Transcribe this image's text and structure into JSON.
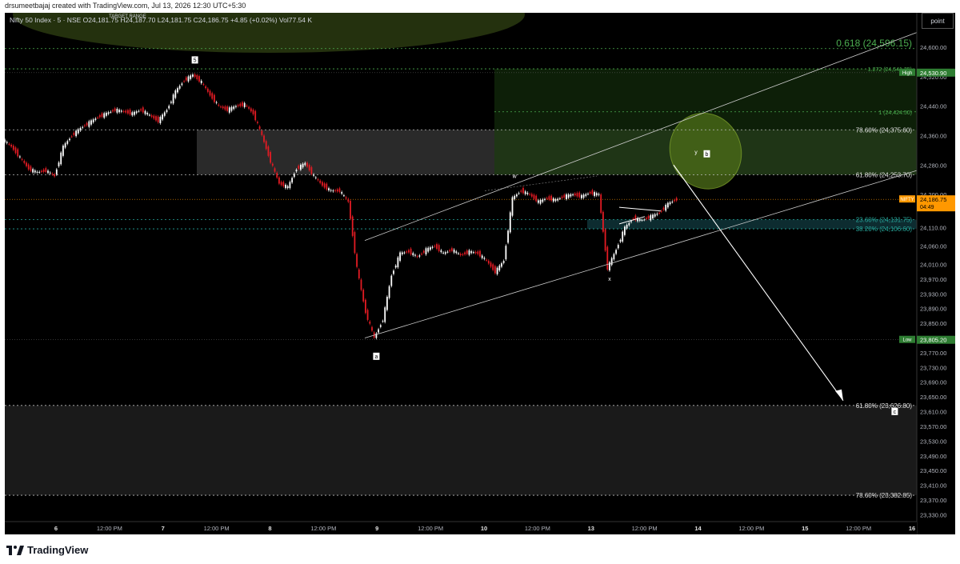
{
  "top_caption": "drsumeetbajaj created with TradingView.com, Jul 13, 2026 12:30 UTC+5:30",
  "symbol_line": "Nifty 50 Index · 5 · NSE  O24,181.75  H24,187.70  L24,181.75  C24,186.75  +4.85 (+0.02%)  Vol77.54 K",
  "target_range_label": "TARGET RANGE",
  "unit_button": "point",
  "branding": "TradingView",
  "colors": {
    "background": "#000000",
    "up_candle": "#ffffff",
    "down_candle": "#e31b23",
    "fib_green": "#4caf50",
    "fib_cyan": "#26a69a",
    "zone_grey": "#2a2a2a",
    "zone_green": "#1b3a12",
    "price_tag": "#ff9800"
  },
  "chart_data": {
    "type": "candlestick",
    "ylim": [
      23320,
      24650
    ],
    "y_ticks": [
      "24,600.00",
      "24,520.00",
      "24,440.00",
      "24,360.00",
      "24,280.00",
      "24,200.00",
      "24,110.00",
      "24,060.00",
      "24,010.00",
      "23,970.00",
      "23,930.00",
      "23,890.00",
      "23,850.00",
      "23,810.00",
      "23,770.00",
      "23,730.00",
      "23,690.00",
      "23,650.00",
      "23,610.00",
      "23,570.00",
      "23,530.00",
      "23,490.00",
      "23,450.00",
      "23,410.00",
      "23,370.00",
      "23,330.00"
    ],
    "x_ticks": [
      "6",
      "12:00 PM",
      "7",
      "12:00 PM",
      "8",
      "12:00 PM",
      "9",
      "12:00 PM",
      "10",
      "12:00 PM",
      "13",
      "12:00 PM",
      "14",
      "12:00 PM",
      "15",
      "12:00 PM",
      "16"
    ],
    "price_path": [
      [
        0,
        24350
      ],
      [
        4,
        24330
      ],
      [
        8,
        24300
      ],
      [
        12,
        24270
      ],
      [
        16,
        24260
      ],
      [
        20,
        24265
      ],
      [
        24,
        24250
      ],
      [
        28,
        24330
      ],
      [
        32,
        24360
      ],
      [
        36,
        24380
      ],
      [
        40,
        24395
      ],
      [
        44,
        24410
      ],
      [
        48,
        24420
      ],
      [
        52,
        24430
      ],
      [
        56,
        24425
      ],
      [
        60,
        24420
      ],
      [
        64,
        24430
      ],
      [
        68,
        24415
      ],
      [
        72,
        24400
      ],
      [
        76,
        24430
      ],
      [
        80,
        24480
      ],
      [
        84,
        24510
      ],
      [
        88,
        24525
      ],
      [
        92,
        24505
      ],
      [
        96,
        24470
      ],
      [
        100,
        24440
      ],
      [
        104,
        24430
      ],
      [
        108,
        24440
      ],
      [
        112,
        24445
      ],
      [
        116,
        24420
      ],
      [
        120,
        24360
      ],
      [
        124,
        24290
      ],
      [
        128,
        24230
      ],
      [
        132,
        24220
      ],
      [
        136,
        24270
      ],
      [
        140,
        24285
      ],
      [
        144,
        24250
      ],
      [
        148,
        24225
      ],
      [
        152,
        24210
      ],
      [
        156,
        24210
      ],
      [
        160,
        24180
      ],
      [
        164,
        24000
      ],
      [
        168,
        23880
      ],
      [
        172,
        23810
      ],
      [
        176,
        23860
      ],
      [
        180,
        23980
      ],
      [
        184,
        24040
      ],
      [
        188,
        24045
      ],
      [
        192,
        24030
      ],
      [
        196,
        24050
      ],
      [
        200,
        24060
      ],
      [
        204,
        24040
      ],
      [
        208,
        24050
      ],
      [
        212,
        24035
      ],
      [
        216,
        24045
      ],
      [
        220,
        24040
      ],
      [
        224,
        24020
      ],
      [
        228,
        23990
      ],
      [
        232,
        24020
      ],
      [
        236,
        24190
      ],
      [
        240,
        24210
      ],
      [
        244,
        24200
      ],
      [
        248,
        24180
      ],
      [
        252,
        24190
      ],
      [
        256,
        24185
      ],
      [
        260,
        24195
      ],
      [
        264,
        24200
      ],
      [
        268,
        24195
      ],
      [
        272,
        24205
      ],
      [
        276,
        24200
      ],
      [
        280,
        24000
      ],
      [
        284,
        24050
      ],
      [
        288,
        24110
      ],
      [
        292,
        24135
      ],
      [
        296,
        24130
      ],
      [
        300,
        24140
      ],
      [
        304,
        24150
      ],
      [
        308,
        24175
      ],
      [
        312,
        24186.75
      ]
    ],
    "horizontal_levels": [
      {
        "label": "0.618 (24,596.15)",
        "value": 24596.15,
        "color": "fib_green"
      },
      {
        "label": "1.272 (24,541.25)",
        "value": 24541.25,
        "color": "fib_green"
      },
      {
        "label": "1 (24,424.50)",
        "value": 24424.5,
        "color": "fib_green"
      },
      {
        "label": "78.60% (24,375.60)",
        "value": 24375.6,
        "color": "white"
      },
      {
        "label": "61.80% (24,253.70)",
        "value": 24253.7,
        "color": "white"
      },
      {
        "label": "23.60% (24,131.75)",
        "value": 24131.75,
        "color": "fib_cyan"
      },
      {
        "label": "38.20% (24,106.60)",
        "value": 24106.6,
        "color": "fib_cyan"
      },
      {
        "label": "61.80% (23,626.80)",
        "value": 23626.8,
        "color": "white"
      },
      {
        "label": "78.60% (23,382.85)",
        "value": 23382.85,
        "color": "white"
      }
    ],
    "price_tags": [
      {
        "label": "High",
        "value_text": "24,530.90",
        "value": 24530.9
      },
      {
        "label": "NIFTY",
        "value_text": "24,186.75",
        "value": 24186.75,
        "sub": "04:49"
      },
      {
        "label": "Low",
        "value_text": "23,805.20",
        "value": 23805.2
      }
    ],
    "wave_labels": [
      {
        "text": "5",
        "price": 24560,
        "bar": 88
      },
      {
        "text": "a",
        "price": 23755,
        "bar": 172
      },
      {
        "text": "w",
        "price": 24245,
        "bar": 236
      },
      {
        "text": "x",
        "price": 23965,
        "bar": 280
      },
      {
        "text": "y",
        "price": 24310,
        "bar": 320
      },
      {
        "text": "b",
        "price": 24305,
        "bar": 325
      },
      {
        "text": "c",
        "price": 23605,
        "bar": 412
      }
    ]
  }
}
